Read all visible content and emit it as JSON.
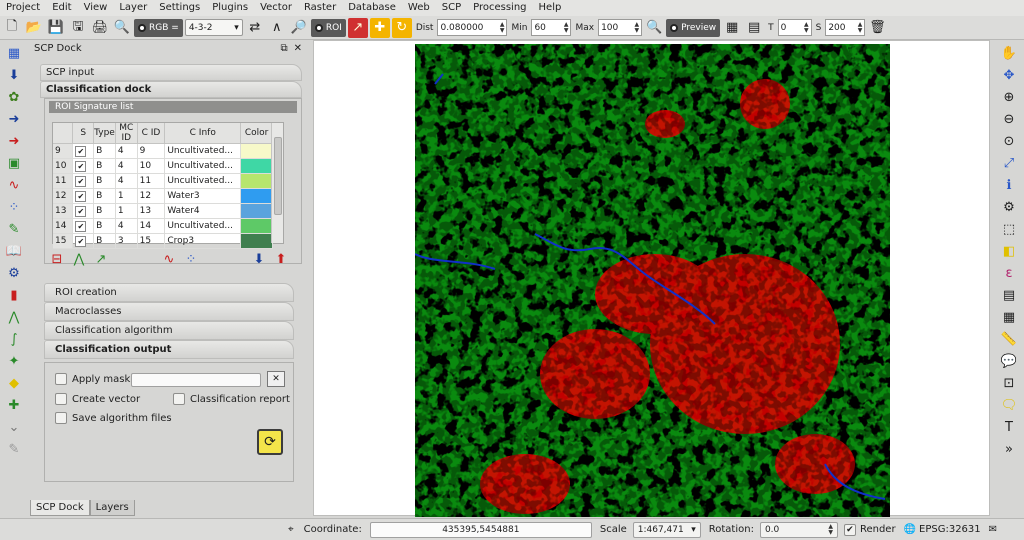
{
  "menubar": {
    "items": [
      "Project",
      "Edit",
      "View",
      "Layer",
      "Settings",
      "Plugins",
      "Vector",
      "Raster",
      "Database",
      "Web",
      "SCP",
      "Processing",
      "Help"
    ]
  },
  "toolbar": {
    "rgb_label": "RGB =",
    "rgb_value": "4-3-2",
    "roi_label": "ROI",
    "dist_label": "Dist",
    "dist_value": "0.080000",
    "min_label": "Min",
    "min_value": "60",
    "max_label": "Max",
    "max_value": "100",
    "preview_label": "Preview",
    "t_label": "T",
    "t_value": "0",
    "s_label": "S",
    "s_value": "200"
  },
  "dock": {
    "title": "SCP Dock",
    "float_glyph": "⧉",
    "close_glyph": "✕",
    "tab_scp_input": "SCP input",
    "tab_classification_dock": "Classification dock",
    "roi_signature_list_title": "ROI Signature list",
    "table": {
      "headers": [
        "S",
        "Type",
        "MC ID",
        "C ID",
        "C Info",
        "Color"
      ],
      "rows": [
        {
          "num": "9",
          "checked": true,
          "type": "B",
          "mc_id": "4",
          "c_id": "9",
          "c_info": "Uncultivated...",
          "color": "#f7f9c9"
        },
        {
          "num": "10",
          "checked": true,
          "type": "B",
          "mc_id": "4",
          "c_id": "10",
          "c_info": "Uncultivated...",
          "color": "#3fd7a5"
        },
        {
          "num": "11",
          "checked": true,
          "type": "B",
          "mc_id": "4",
          "c_id": "11",
          "c_info": "Uncultivated...",
          "color": "#b7e56e"
        },
        {
          "num": "12",
          "checked": true,
          "type": "B",
          "mc_id": "1",
          "c_id": "12",
          "c_info": "Water3",
          "color": "#2f9cf0"
        },
        {
          "num": "13",
          "checked": true,
          "type": "B",
          "mc_id": "1",
          "c_id": "13",
          "c_info": "Water4",
          "color": "#5aa3dd"
        },
        {
          "num": "14",
          "checked": true,
          "type": "B",
          "mc_id": "4",
          "c_id": "14",
          "c_info": "Uncultivated...",
          "color": "#5ec967"
        },
        {
          "num": "15",
          "checked": true,
          "type": "B",
          "mc_id": "3",
          "c_id": "15",
          "c_info": "Crop3",
          "color": "#3f7f4f"
        }
      ]
    },
    "sections": [
      "ROI creation",
      "Macroclasses",
      "Classification algorithm",
      "Classification output"
    ],
    "output": {
      "apply_mask": "Apply mask",
      "create_vector": "Create vector",
      "classification_report": "Classification report",
      "save_algorithm_files": "Save algorithm files"
    },
    "bottom_tabs": [
      "SCP Dock",
      "Layers"
    ]
  },
  "map": {
    "class_colors": {
      "vegetation": "#0a8a0f",
      "crop": "#f4f400",
      "urban": "#e40000",
      "water": "#1030c8"
    }
  },
  "statusbar": {
    "coordinate_label": "Coordinate:",
    "coordinate_value": "435395,5454881",
    "scale_label": "Scale",
    "scale_value": "1:467,471",
    "rotation_label": "Rotation:",
    "rotation_value": "0.0",
    "render_label": "Render",
    "render_checkmark": "✔",
    "epsg_label": "EPSG:32631"
  },
  "icons": {
    "new_icon": "🗋",
    "open_icon": "📂",
    "save_icon": "💾",
    "save_as_icon": "🖫",
    "print_icon": "🖨",
    "zoom_icon": "🔍",
    "arrow_icon": "↗",
    "rgb_dropdown_arrow": "▾",
    "swap_icon": "⇄",
    "spectral_icon": "∧",
    "zoom_roi_icon": "🔎",
    "add_icon": "✚",
    "redo_icon": "↻",
    "preview_icon": "🔍",
    "layers_icon": "▦",
    "chart_icon": "▤",
    "trash_icon": "🗑",
    "pan_icon": "✋"
  }
}
